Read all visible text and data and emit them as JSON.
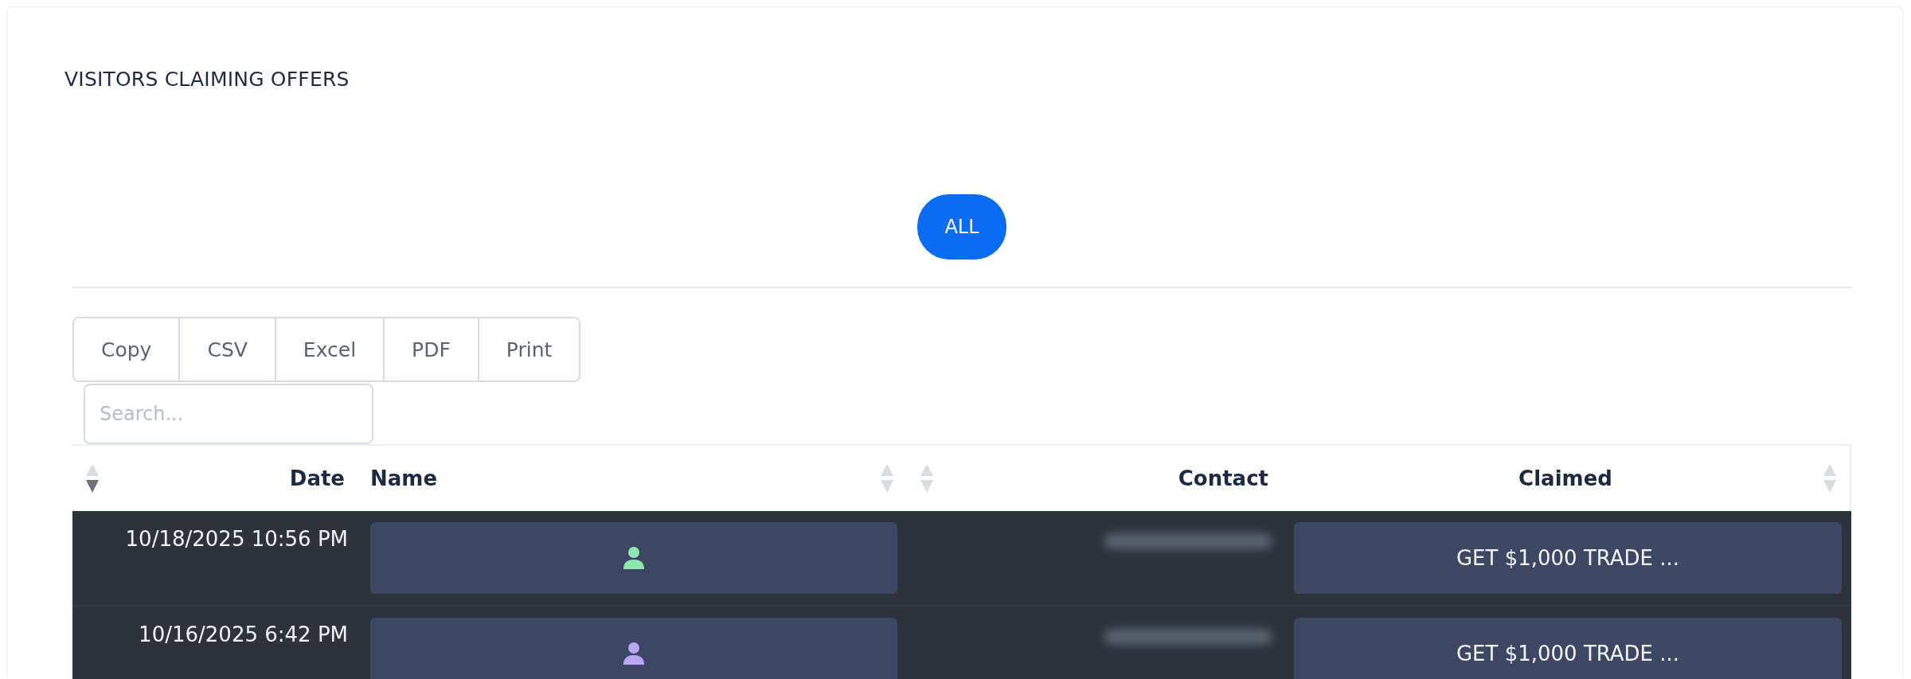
{
  "title": "VISITORS CLAIMING OFFERS",
  "filters": [
    {
      "label": "ALL",
      "selected": true
    }
  ],
  "export_buttons": [
    "Copy",
    "CSV",
    "Excel",
    "PDF",
    "Print"
  ],
  "search": {
    "placeholder": "Search..."
  },
  "table": {
    "columns": [
      {
        "label": "Date",
        "sorted": true
      },
      {
        "label": "Name",
        "sorted": false
      },
      {
        "label": "Contact",
        "sorted": false
      },
      {
        "label": "Claimed",
        "sorted": false
      }
    ],
    "rows": [
      {
        "date": "10/18/2025 10:56 PM",
        "name": {
          "color": "#8ee6b0"
        },
        "contact_redacted": true,
        "claimed": "GET $1,000 TRADE ..."
      },
      {
        "date": "10/16/2025 6:42 PM",
        "name": {
          "color": "#b9a6f3"
        },
        "contact_redacted": true,
        "claimed": "GET $1,000 TRADE ..."
      }
    ]
  }
}
